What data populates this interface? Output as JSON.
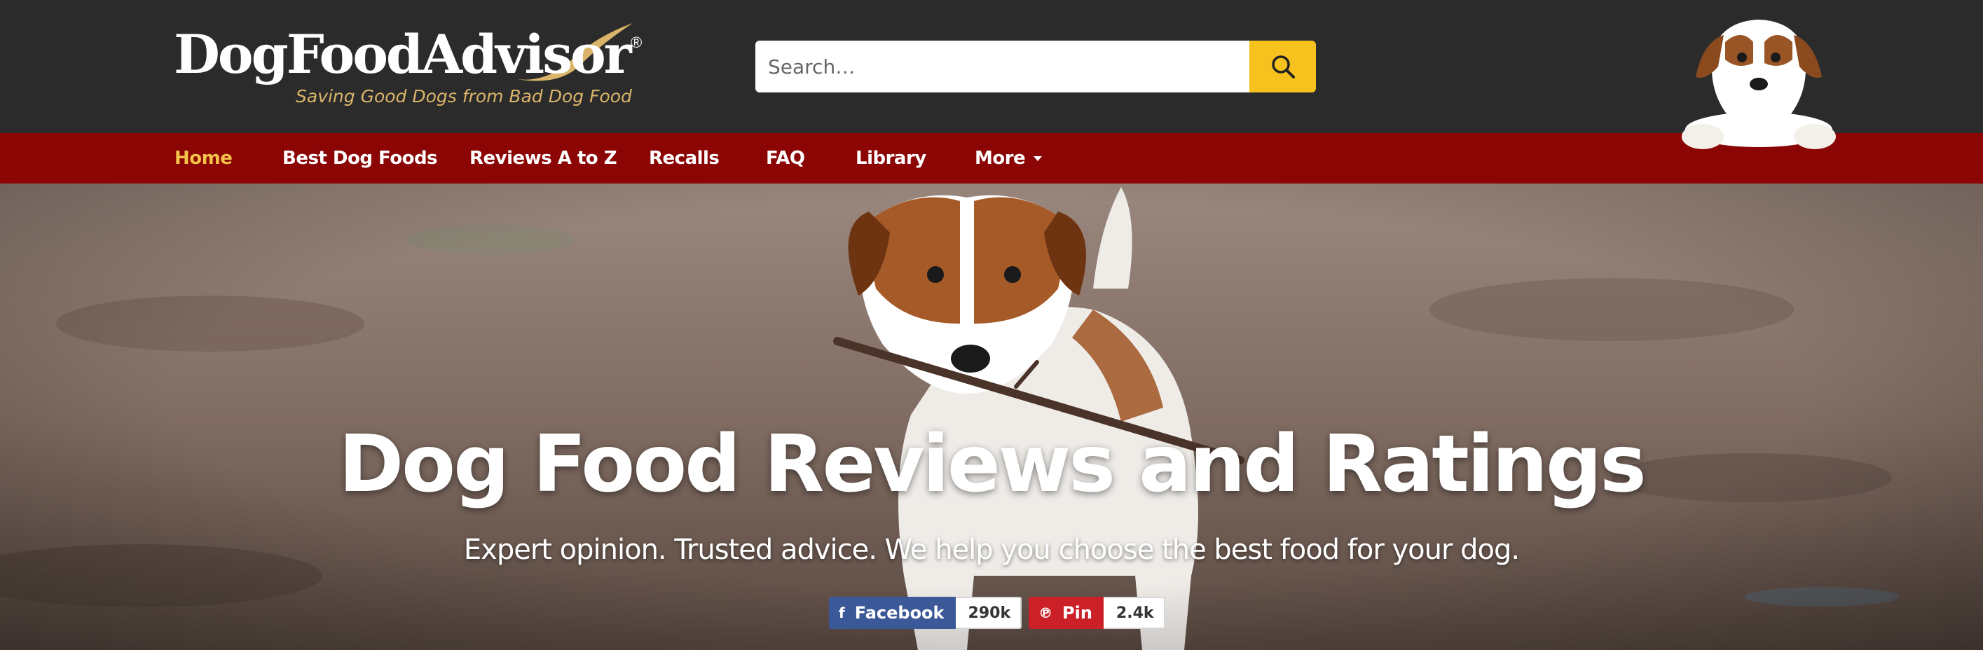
{
  "logo": {
    "name": "DogFoodAdvisor",
    "registered": "®",
    "tagline": "Saving Good Dogs from Bad Dog Food"
  },
  "search": {
    "placeholder": "Search…",
    "icon": "search-icon"
  },
  "nav": {
    "items": [
      {
        "label": "Home",
        "active": true
      },
      {
        "label": "Best Dog Foods"
      },
      {
        "label": "Reviews A to Z"
      },
      {
        "label": "Recalls"
      },
      {
        "label": "FAQ"
      },
      {
        "label": "Library"
      },
      {
        "label": "More",
        "has_dropdown": true
      }
    ]
  },
  "hero": {
    "title": "Dog Food Reviews and Ratings",
    "subtitle": "Expert opinion. Trusted advice. We help you choose the best food for your dog."
  },
  "share": {
    "facebook": {
      "label": "Facebook",
      "count": "290k",
      "icon": "facebook-icon"
    },
    "pinterest": {
      "label": "Pin",
      "count": "2.4k",
      "icon": "pinterest-icon"
    }
  },
  "colors": {
    "header_bg": "#2b2b2b",
    "nav_bg": "#8b0505",
    "nav_active": "#f6c34a",
    "search_button": "#f7c21e",
    "tagline": "#d9b46a",
    "facebook": "#3b5998",
    "pinterest": "#cb2027"
  }
}
